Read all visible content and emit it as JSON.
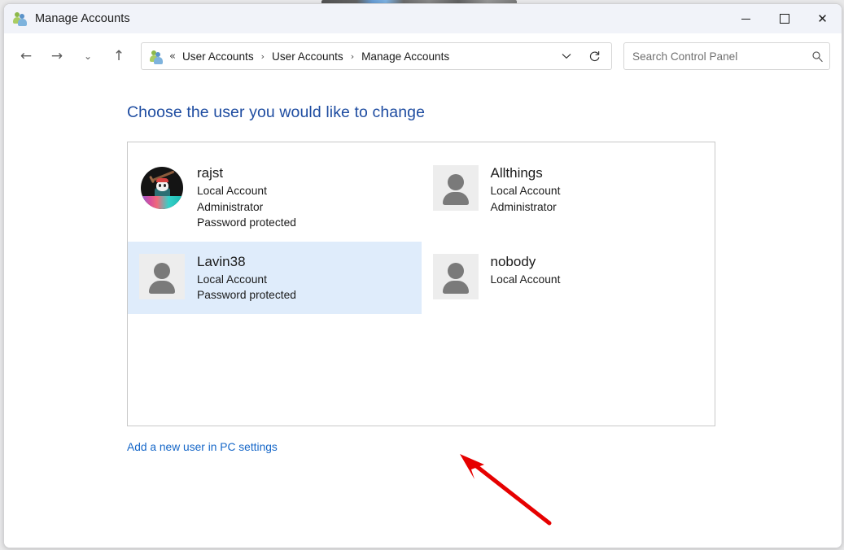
{
  "window": {
    "title": "Manage Accounts",
    "title_icon": "users-icon",
    "controls": {
      "minimize": "minimize-icon",
      "maximize": "maximize-icon",
      "close": "close-icon"
    }
  },
  "toolbar": {
    "back": "back-arrow-icon",
    "forward": "forward-arrow-icon",
    "recent": "chevron-down-icon",
    "up": "up-arrow-icon",
    "refresh": "refresh-icon",
    "breadcrumb": {
      "icon": "users-icon",
      "overflow": "«",
      "items": [
        "User Accounts",
        "User Accounts",
        "Manage Accounts"
      ],
      "separator": "›",
      "dropdown": "chevron-down-icon"
    }
  },
  "search": {
    "placeholder": "Search Control Panel",
    "value": "",
    "icon": "search-icon"
  },
  "main": {
    "heading": "Choose the user you would like to change",
    "accounts": [
      {
        "name": "rajst",
        "account_type": "Local Account",
        "role": "Administrator",
        "password": "Password protected",
        "avatar": "custom-photo",
        "selected": false
      },
      {
        "name": "Allthings",
        "account_type": "Local Account",
        "role": "Administrator",
        "password": "",
        "avatar": "default-person",
        "selected": false
      },
      {
        "name": "Lavin38",
        "account_type": "Local Account",
        "role": "",
        "password": "Password protected",
        "avatar": "default-person",
        "selected": true
      },
      {
        "name": "nobody",
        "account_type": "Local Account",
        "role": "",
        "password": "",
        "avatar": "default-person",
        "selected": false
      }
    ],
    "add_user_link": "Add a new user in PC settings"
  },
  "annotation": {
    "type": "arrow",
    "color": "#e60000",
    "points_to": "Lavin38"
  },
  "colors": {
    "heading": "#1f4da1",
    "link": "#1667c8",
    "selection": "#dfecfb",
    "titlebar": "#f1f3f9",
    "annotation": "#e60000"
  }
}
